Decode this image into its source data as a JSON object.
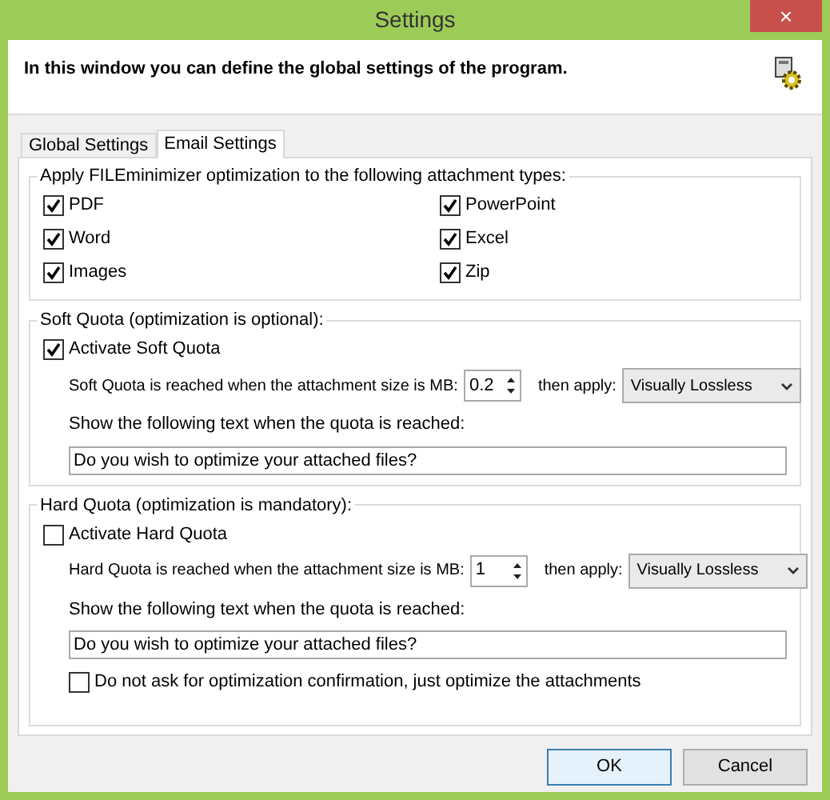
{
  "window": {
    "title": "Settings",
    "close": "×"
  },
  "header": {
    "text": "In this window you can define the global settings of the program."
  },
  "tabs": [
    {
      "label": "Global Settings",
      "selected": false
    },
    {
      "label": "Email Settings",
      "selected": true
    }
  ],
  "attachment_types": {
    "legend": "Apply FILEminimizer optimization to the following attachment types:",
    "items": [
      {
        "label": "PDF",
        "checked": true
      },
      {
        "label": "PowerPoint",
        "checked": true
      },
      {
        "label": "Word",
        "checked": true
      },
      {
        "label": "Excel",
        "checked": true
      },
      {
        "label": "Images",
        "checked": true
      },
      {
        "label": "Zip",
        "checked": true
      }
    ]
  },
  "soft_quota": {
    "legend": "Soft Quota (optimization is optional):",
    "activate": {
      "label": "Activate Soft Quota",
      "checked": true
    },
    "size_label": "Soft Quota is reached when the attachment size is MB:",
    "size_value": "0.2",
    "apply_label": "then apply:",
    "apply_value": "Visually Lossless",
    "text_label": "Show the following text when the quota is reached:",
    "text_value": "Do you wish to optimize your attached files?"
  },
  "hard_quota": {
    "legend": "Hard Quota (optimization is mandatory):",
    "activate": {
      "label": "Activate Hard Quota",
      "checked": false
    },
    "size_label": "Hard Quota is reached when the attachment size is MB:",
    "size_value": "1",
    "apply_label": "then apply:",
    "apply_value": "Visually Lossless",
    "text_label": "Show the following text when the quota is reached:",
    "text_value": "Do you wish to optimize your attached files?",
    "no_confirm": {
      "label": "Do not ask for optimization confirmation, just optimize the attachments",
      "checked": false
    }
  },
  "buttons": [
    {
      "label": "OK",
      "default": true
    },
    {
      "label": "Cancel",
      "default": false
    }
  ]
}
